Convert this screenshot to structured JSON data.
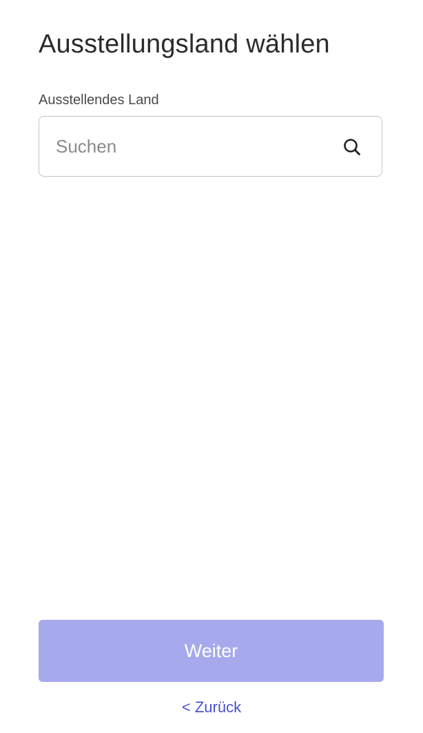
{
  "page": {
    "title": "Ausstellungsland wählen"
  },
  "country_field": {
    "label": "Ausstellendes Land",
    "value": "",
    "placeholder": "Suchen",
    "icon": "search-icon"
  },
  "actions": {
    "continue_label": "Weiter",
    "back_label": "< Zurück"
  },
  "colors": {
    "primary_disabled": "#a6a9ec",
    "link": "#4a4fd1",
    "text": "#2b2b2b",
    "border": "#c4c4c4"
  }
}
